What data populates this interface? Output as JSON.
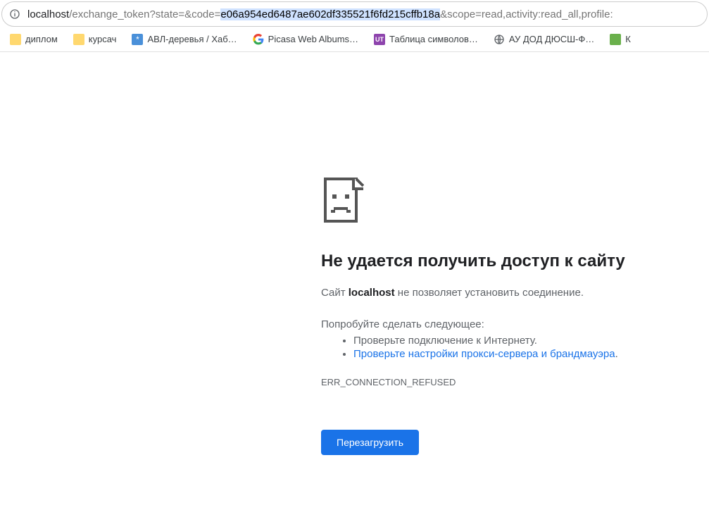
{
  "url": {
    "host": "localhost",
    "path_before": "/exchange_token?state=&code=",
    "selected": "e06a954ed6487ae602df335521f6fd215cffb18a",
    "after": "&scope=read,activity:read_all,profile:"
  },
  "bookmarks": [
    {
      "label": "диплом",
      "icon": "folder"
    },
    {
      "label": "курсач",
      "icon": "folder"
    },
    {
      "label": "АВЛ-деревья / Хаб…",
      "icon": "habr"
    },
    {
      "label": "Picasa Web Albums…",
      "icon": "google"
    },
    {
      "label": "Таблица символов…",
      "icon": "ut"
    },
    {
      "label": "АУ ДОД ДЮСШ-Ф…",
      "icon": "globe"
    },
    {
      "label": "К",
      "icon": "green"
    }
  ],
  "error": {
    "heading": "Не удается получить доступ к сайту",
    "msg_prefix": "Сайт ",
    "msg_host": "localhost",
    "msg_suffix": " не позволяет установить соединение.",
    "suggest_title": "Попробуйте сделать следующее:",
    "suggest1": "Проверьте подключение к Интернету.",
    "suggest2": "Проверьте настройки прокси-сервера и брандмауэра",
    "code": "ERR_CONNECTION_REFUSED",
    "reload": "Перезагрузить"
  }
}
